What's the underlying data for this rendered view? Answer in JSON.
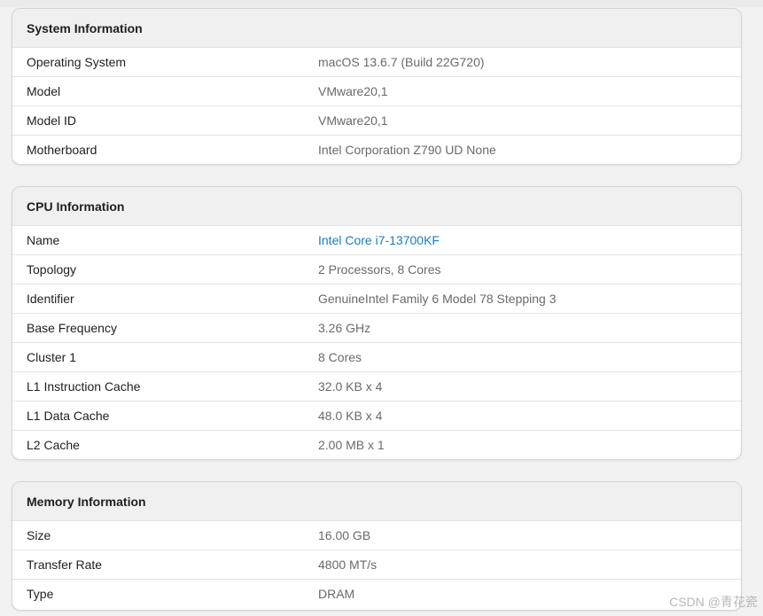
{
  "sections": [
    {
      "title": "System Information",
      "rows": [
        {
          "label": "Operating System",
          "value": "macOS 13.6.7 (Build 22G720)"
        },
        {
          "label": "Model",
          "value": "VMware20,1"
        },
        {
          "label": "Model ID",
          "value": "VMware20,1"
        },
        {
          "label": "Motherboard",
          "value": "Intel Corporation Z790 UD None"
        }
      ]
    },
    {
      "title": "CPU Information",
      "rows": [
        {
          "label": "Name",
          "value": "Intel Core i7-13700KF"
        },
        {
          "label": "Topology",
          "value": "2 Processors, 8 Cores"
        },
        {
          "label": "Identifier",
          "value": "GenuineIntel Family 6 Model 78 Stepping 3"
        },
        {
          "label": "Base Frequency",
          "value": "3.26 GHz"
        },
        {
          "label": "Cluster 1",
          "value": "8 Cores"
        },
        {
          "label": "L1 Instruction Cache",
          "value": "32.0 KB x 4"
        },
        {
          "label": "L1 Data Cache",
          "value": "48.0 KB x 4"
        },
        {
          "label": "L2 Cache",
          "value": "2.00 MB x 1"
        }
      ]
    },
    {
      "title": "Memory Information",
      "rows": [
        {
          "label": "Size",
          "value": "16.00 GB"
        },
        {
          "label": "Transfer Rate",
          "value": "4800 MT/s"
        },
        {
          "label": "Type",
          "value": "DRAM"
        }
      ]
    }
  ],
  "watermark": "CSDN @青花瓷",
  "colors": {
    "link": "#1a7cc4",
    "header_bg": "#f0f0f0",
    "value_text": "#6a6a6a"
  }
}
